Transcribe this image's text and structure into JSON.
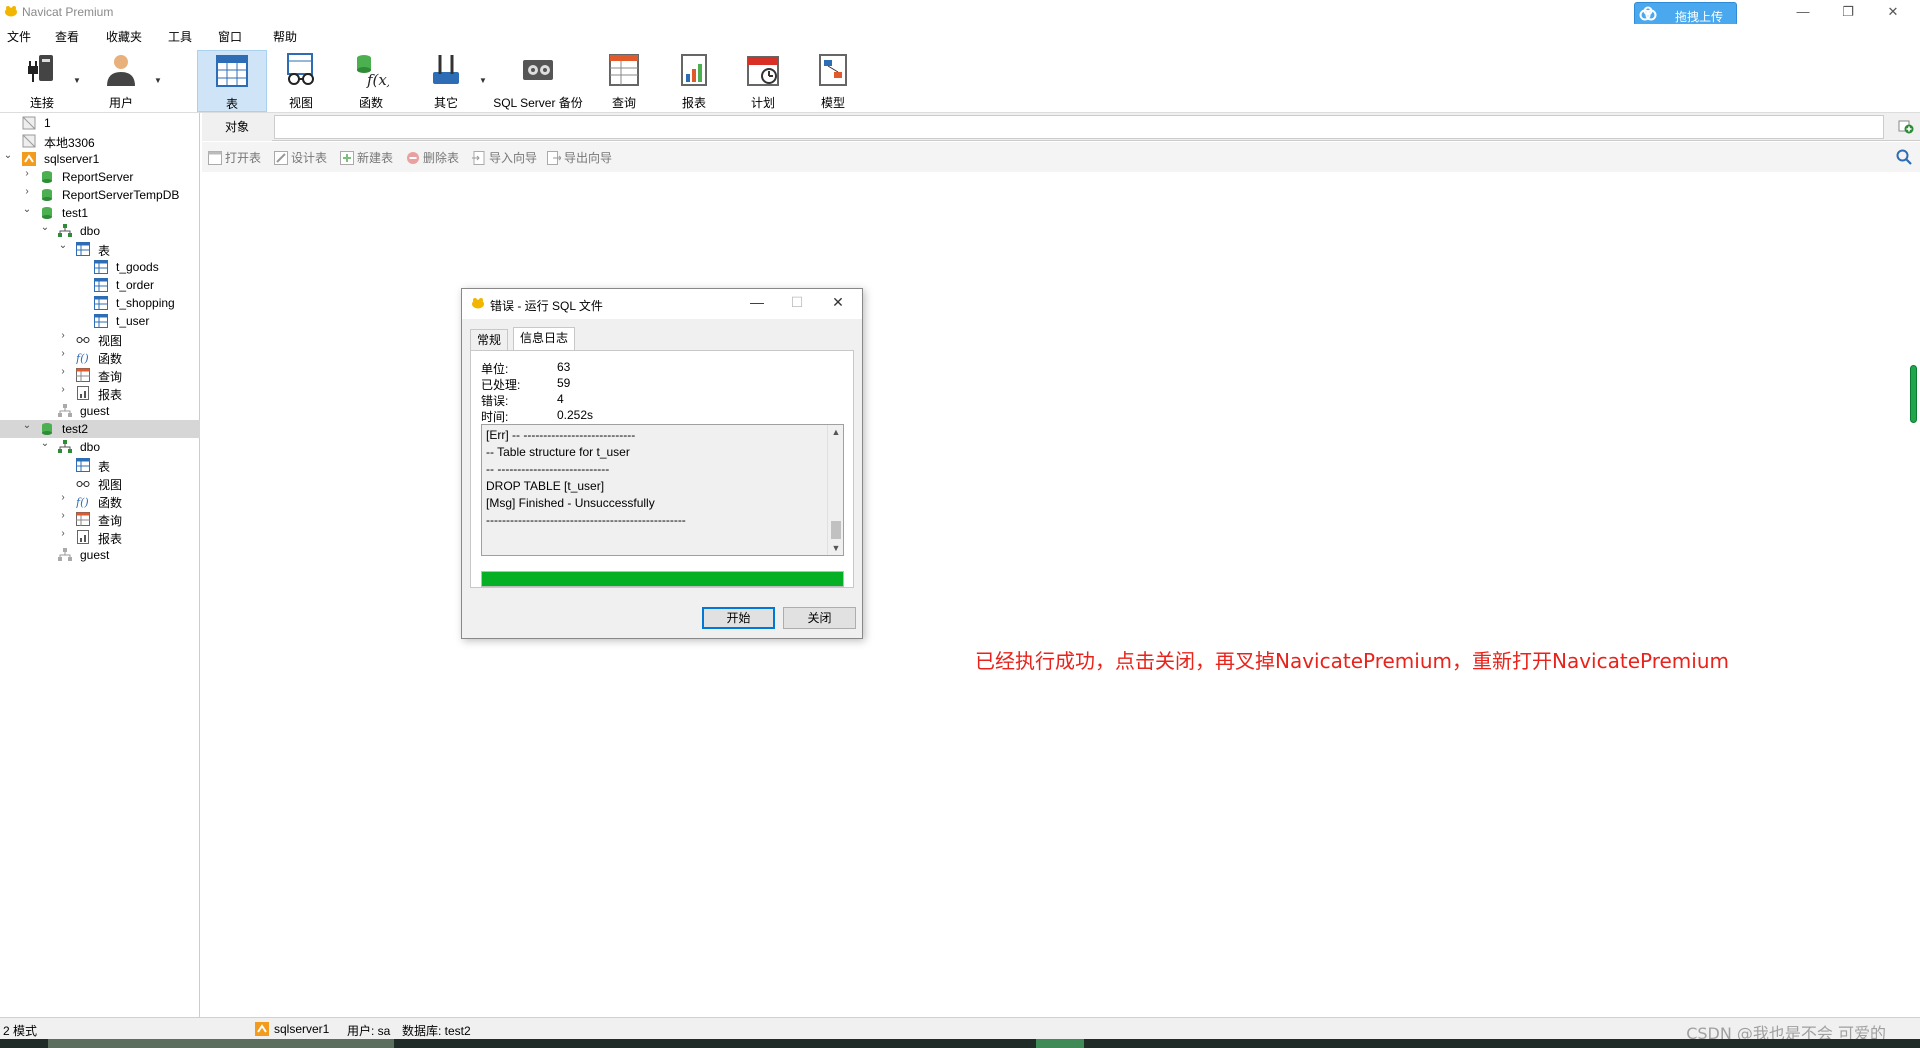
{
  "window": {
    "title": "Navicat Premium",
    "upload_label": "拖拽上传",
    "minimize": "—",
    "restore": "❐",
    "close": "✕"
  },
  "menu": [
    "文件",
    "查看",
    "收藏夹",
    "工具",
    "窗口",
    "帮助"
  ],
  "toolbar": {
    "connect": "连接",
    "user": "用户",
    "table": "表",
    "view": "视图",
    "function": "函数",
    "other": "其它",
    "backup": "SQL Server 备份",
    "query": "查询",
    "report": "报表",
    "schedule": "计划",
    "model": "模型"
  },
  "tree": {
    "n1": "1",
    "local": "本地3306",
    "sqlserver1": "sqlserver1",
    "reportserver": "ReportServer",
    "reportservertemp": "ReportServerTempDB",
    "test1": "test1",
    "dbo1": "dbo",
    "tables1": "表",
    "t_goods": "t_goods",
    "t_order": "t_order",
    "t_shopping": "t_shopping",
    "t_user": "t_user",
    "views1": "视图",
    "funcs1": "函数",
    "queries1": "查询",
    "reports1": "报表",
    "guest1": "guest",
    "test2": "test2",
    "dbo2": "dbo",
    "tables2": "表",
    "views2": "视图",
    "funcs2": "函数",
    "queries2": "查询",
    "reports2": "报表",
    "guest2": "guest"
  },
  "objects": {
    "tab": "对象",
    "tools": {
      "open": "打开表",
      "design": "设计表",
      "new": "新建表",
      "delete": "删除表",
      "import": "导入向导",
      "export": "导出向导"
    }
  },
  "dialog": {
    "title": "错误 - 运行 SQL 文件",
    "tabs": {
      "general": "常规",
      "log": "信息日志"
    },
    "stats": {
      "unit_label": "单位:",
      "unit_value": "63",
      "processed_label": "已处理:",
      "processed_value": "59",
      "error_label": "错误:",
      "error_value": "4",
      "time_label": "时间:",
      "time_value": "0.252s"
    },
    "log": {
      "l1": "[Err] -- ----------------------------",
      "l2": "-- Table structure for t_user",
      "l3": "-- ----------------------------",
      "l4": "DROP TABLE [t_user]",
      "l5": "[Msg] Finished - Unsuccessfully",
      "l6": "--------------------------------------------------"
    },
    "progress": 1.0,
    "start": "开始",
    "close": "关闭"
  },
  "annotation": "已经执行成功，点击关闭，再叉掉NavicatePremium，重新打开NavicatePremium",
  "status": {
    "schemas": "2 模式",
    "connection": "sqlserver1",
    "user": "用户: sa",
    "database": "数据库: test2",
    "watermark": "CSDN @我也是不会 可爱的"
  },
  "colors": {
    "accent_green": "#06b025",
    "annotation_red": "#e8231b",
    "upload_blue": "#4aa8ee"
  }
}
